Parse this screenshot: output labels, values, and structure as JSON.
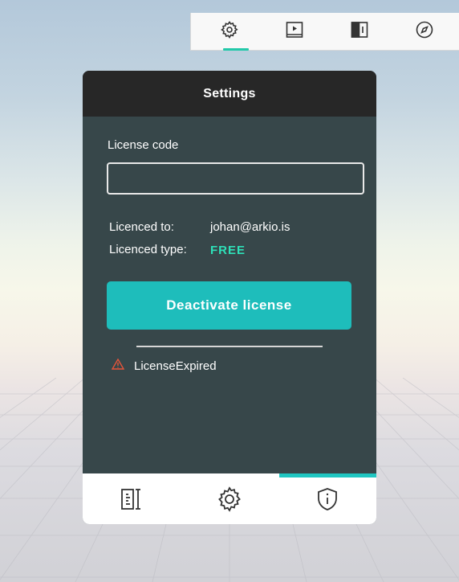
{
  "top_toolbar": {
    "items": [
      {
        "icon": "gear-icon",
        "active": true
      },
      {
        "icon": "video-panel-icon",
        "active": false
      },
      {
        "icon": "split-view-icon",
        "active": false
      },
      {
        "icon": "compass-icon",
        "active": false
      }
    ],
    "accent_color": "#23c9a9"
  },
  "panel": {
    "title": "Settings",
    "license_code_label": "License code",
    "license_code_value": "",
    "licenced_to_label": "Licenced to:",
    "licenced_to_value": "johan@arkio.is",
    "licenced_type_label": "Licenced type:",
    "licenced_type_value": "FREE",
    "deactivate_button_label": "Deactivate license",
    "status_message": "LicenseExpired",
    "status_icon": "warning-icon",
    "colors": {
      "header": "#272727",
      "body": "#37474a",
      "button": "#1ebdbb",
      "type_value": "#2ee0b8",
      "warning": "#e8553a"
    }
  },
  "bottom_tabs": {
    "items": [
      {
        "icon": "ruler-book-icon",
        "active": false
      },
      {
        "icon": "gear-icon",
        "active": false
      },
      {
        "icon": "shield-info-icon",
        "active": true
      }
    ],
    "accent_color": "#1fc6c1"
  }
}
